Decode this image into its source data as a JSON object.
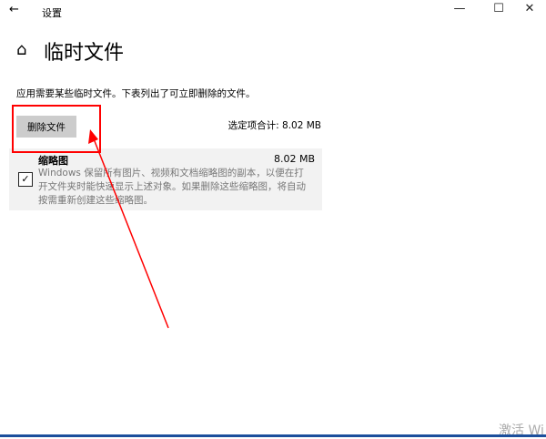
{
  "window": {
    "title": "设置",
    "minimize": "—",
    "maximize": "☐",
    "close": "✕",
    "back": "←"
  },
  "page": {
    "title": "临时文件",
    "home_icon": "home-icon",
    "description": "应用需要某些临时文件。下表列出了可立即删除的文件。"
  },
  "actions": {
    "delete_label": "删除文件",
    "total": "选定项合计: 8.02 MB"
  },
  "items": [
    {
      "name": "缩略图",
      "size": "8.02 MB",
      "checked": true,
      "description": "Windows 保留所有图片、视频和文档缩略图的副本，以便在打开文件夹时能快速显示上述对象。如果删除这些缩略图，将自动按需重新创建这些缩略图。"
    }
  ],
  "watermark": "激活 Wi",
  "colors": {
    "annotation": "#ff0000",
    "taskbar": "#1c4f9c"
  }
}
